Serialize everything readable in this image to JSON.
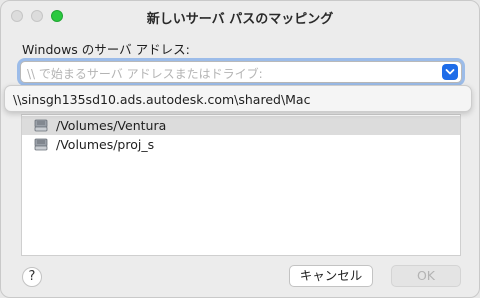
{
  "window": {
    "title": "新しいサーバ パスのマッピング"
  },
  "form": {
    "address_label": "Windows のサーバ アドレス:",
    "address_placeholder": "\\\\ で始まるサーバ アドレスまたはドライブ:"
  },
  "autocomplete": {
    "suggestion": "\\\\sinsgh135sd10.ads.autodesk.com\\shared\\Mac"
  },
  "list": {
    "items": [
      {
        "label": "/Volumes/Ventura",
        "icon": "drive-icon",
        "selected": true
      },
      {
        "label": "/Volumes/proj_s",
        "icon": "drive-icon",
        "selected": false
      }
    ]
  },
  "buttons": {
    "help": "?",
    "cancel": "キャンセル",
    "ok": "OK"
  },
  "colors": {
    "accent": "#1e6ce8",
    "maximize": "#2bc940"
  }
}
